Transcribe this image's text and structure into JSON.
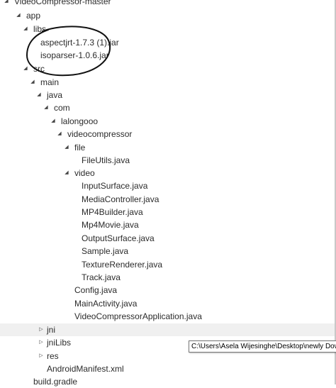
{
  "tree": {
    "items": [
      {
        "label": "VideoCompressor-master",
        "expanded": true
      },
      {
        "label": "app",
        "expanded": true
      },
      {
        "label": "libs",
        "expanded": true
      },
      {
        "label": "aspectjrt-1.7.3 (1).jar"
      },
      {
        "label": "isoparser-1.0.6.jar"
      },
      {
        "label": "src",
        "expanded": true
      },
      {
        "label": "main",
        "expanded": true
      },
      {
        "label": "java",
        "expanded": true
      },
      {
        "label": "com",
        "expanded": true
      },
      {
        "label": "lalongooo",
        "expanded": true
      },
      {
        "label": "videocompressor",
        "expanded": true
      },
      {
        "label": "file",
        "expanded": true
      },
      {
        "label": "FileUtils.java"
      },
      {
        "label": "video",
        "expanded": true
      },
      {
        "label": "InputSurface.java"
      },
      {
        "label": "MediaController.java"
      },
      {
        "label": "MP4Builder.java"
      },
      {
        "label": "Mp4Movie.java"
      },
      {
        "label": "OutputSurface.java"
      },
      {
        "label": "Sample.java"
      },
      {
        "label": "TextureRenderer.java"
      },
      {
        "label": "Track.java"
      },
      {
        "label": "Config.java"
      },
      {
        "label": "MainActivity.java"
      },
      {
        "label": "VideoCompressorApplication.java"
      },
      {
        "label": "jni",
        "expanded": false
      },
      {
        "label": "jniLibs",
        "expanded": false
      },
      {
        "label": "res",
        "expanded": false
      },
      {
        "label": "AndroidManifest.xml"
      },
      {
        "label": "build.gradle"
      }
    ]
  },
  "tooltip": {
    "text": "C:\\Users\\Asela Wijesinghe\\Desktop\\newly Dow"
  },
  "icons": {
    "expanded": "triangle-down-icon",
    "collapsed": "triangle-right-icon"
  },
  "colors": {
    "background": "#ffffff",
    "text": "#2b2b2b",
    "hover_row": "#f0f0f0",
    "annotation": "#111111"
  }
}
